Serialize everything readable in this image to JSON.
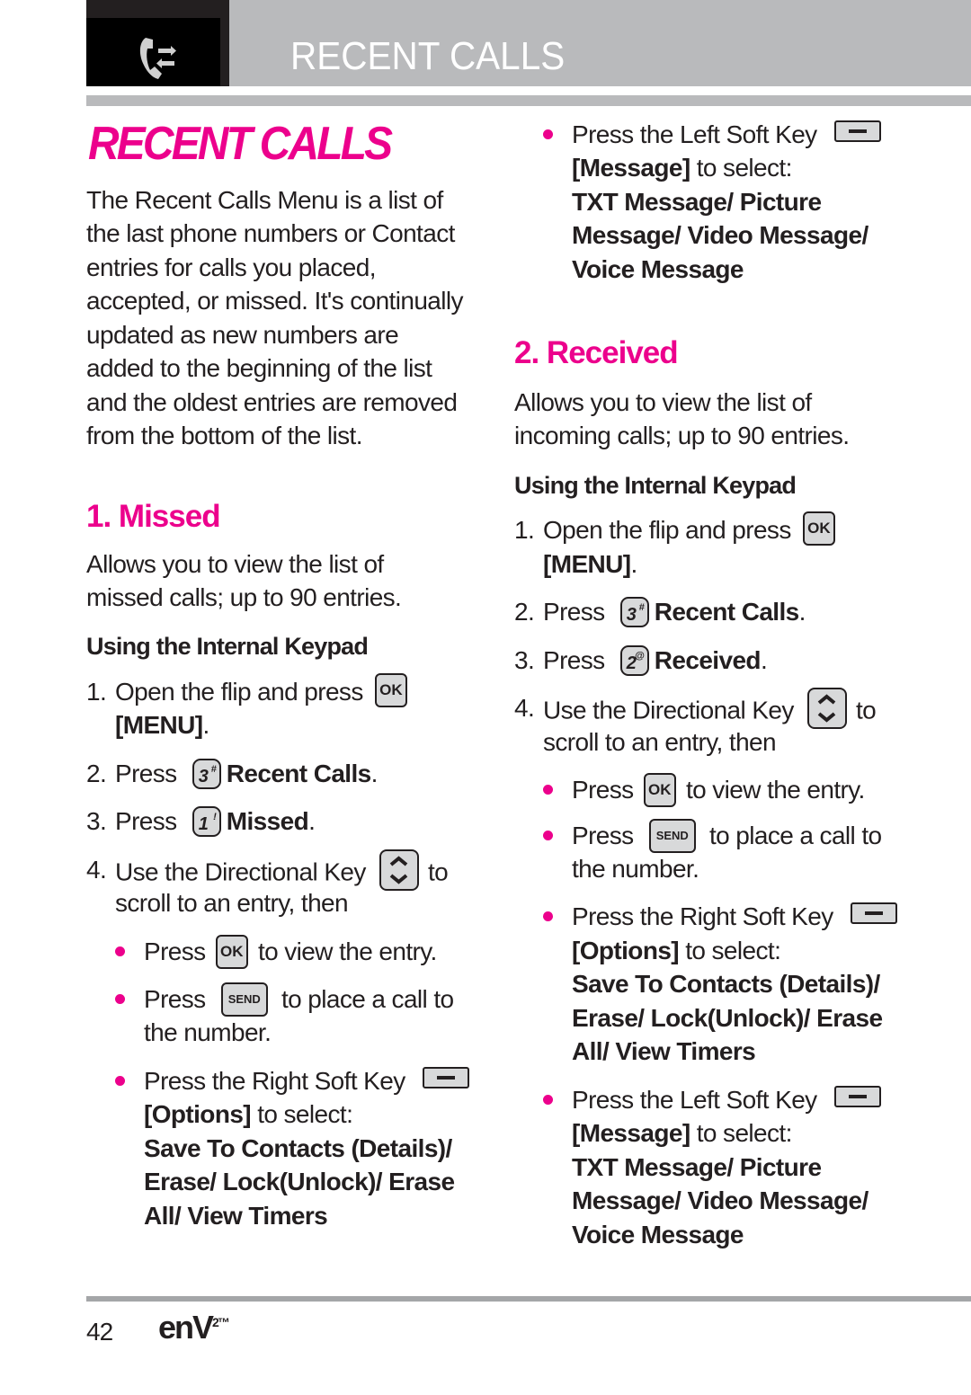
{
  "header": {
    "icon": "recent-calls-phone-icon",
    "title": "RECENT CALLS"
  },
  "page_title": "RECENT CALLS",
  "intro": [
    "The Recent Calls Menu is a list of",
    "the last phone numbers or Contact",
    "entries for calls you placed,",
    "accepted, or missed. It's continually",
    "updated as new numbers are",
    "added to the beginning of the list",
    "and the oldest entries are removed",
    "from the bottom of the list."
  ],
  "colors": {
    "accent": "#ec008c",
    "header_gray": "#b9babc",
    "text": "#231f20"
  },
  "missed": {
    "title": "1. Missed",
    "desc": [
      "Allows you to view the list of",
      "missed calls; up to 90 entries."
    ],
    "subtitle": "Using the Internal Keypad",
    "steps": {
      "s1": {
        "num": "1.",
        "pre": "Open the flip and press",
        "key": "OK",
        "line2": "[MENU]",
        "line2_end": "."
      },
      "s2": {
        "num": "2.",
        "pre": "Press",
        "key": "3",
        "key_sup": "#",
        "bold": "Recent Calls",
        "end": "."
      },
      "s3": {
        "num": "3.",
        "pre": "Press",
        "key": "1",
        "key_sup": "!",
        "bold": "Missed",
        "end": "."
      },
      "s4": {
        "num": "4.",
        "pre": "Use the Directional Key",
        "post": "to",
        "line2": "scroll to an entry, then"
      }
    },
    "bullets": {
      "b1": {
        "pre": "Press",
        "key": "OK",
        "post": "to view the entry."
      },
      "b2": {
        "pre": "Press",
        "key": "SEND",
        "post": "to place a call to",
        "line2": "the number."
      },
      "b3": {
        "pre": "Press the Right Soft Key",
        "bold_bracket": "[Options]",
        "after": " to select:",
        "options": [
          "Save To Contacts (Details)/",
          "Erase/ Lock(Unlock)/ Erase",
          "All/ View Timers"
        ]
      }
    }
  },
  "left_soft_top": {
    "pre": "Press the Left Soft Key",
    "bold_bracket": "[Message]",
    "after": " to select:",
    "options": [
      "TXT Message/ Picture",
      "Message/ Video Message/",
      "Voice Message"
    ]
  },
  "received": {
    "title": "2. Received",
    "desc": [
      "Allows you to view the list of",
      "incoming calls; up to 90 entries."
    ],
    "subtitle": "Using the Internal Keypad",
    "steps": {
      "s1": {
        "num": "1.",
        "pre": "Open the flip and press",
        "key": "OK",
        "line2": "[MENU]",
        "line2_end": "."
      },
      "s2": {
        "num": "2.",
        "pre": "Press",
        "key": "3",
        "key_sup": "#",
        "bold": "Recent Calls",
        "end": "."
      },
      "s3": {
        "num": "3.",
        "pre": "Press",
        "key": "2",
        "key_sup": "@",
        "bold": "Received",
        "end": "."
      },
      "s4": {
        "num": "4.",
        "pre": "Use the Directional Key",
        "post": "to",
        "line2": "scroll to an entry, then"
      }
    },
    "bullets": {
      "b1": {
        "pre": "Press",
        "key": "OK",
        "post": "to view the entry."
      },
      "b2": {
        "pre": "Press",
        "key": "SEND",
        "post": "to place a call to",
        "line2": "the number."
      },
      "b3": {
        "pre": "Press the Right Soft Key",
        "bold_bracket": "[Options]",
        "after": " to select:",
        "options": [
          "Save To Contacts (Details)/",
          "Erase/ Lock(Unlock)/ Erase",
          "All/ View Timers"
        ]
      },
      "b4": {
        "pre": "Press the Left Soft Key",
        "bold_bracket": "[Message]",
        "after": " to select:",
        "options": [
          "TXT Message/ Picture",
          "Message/ Video Message/",
          "Voice Message"
        ]
      }
    }
  },
  "footer": {
    "page_number": "42",
    "brand": "enV",
    "brand_sup": "2™"
  }
}
